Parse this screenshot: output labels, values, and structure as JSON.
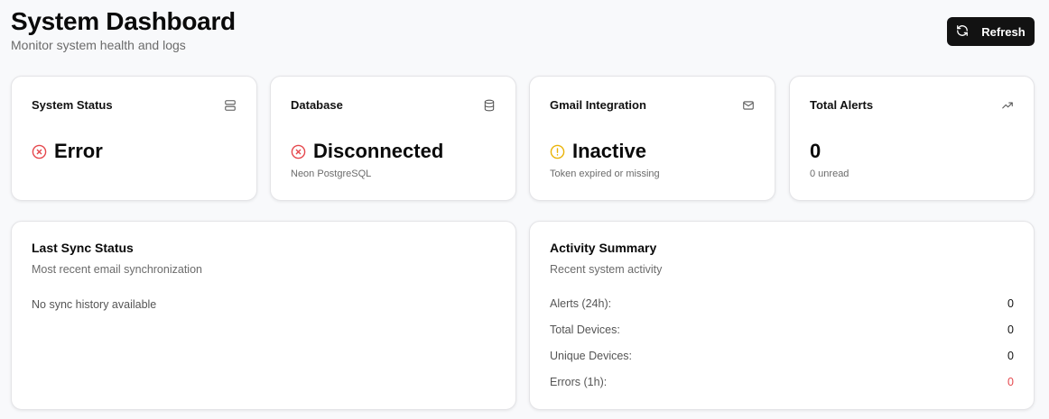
{
  "header": {
    "title": "System Dashboard",
    "subtitle": "Monitor system health and logs",
    "refresh_label": "Refresh"
  },
  "stats": [
    {
      "label": "System Status",
      "icon": "server-icon",
      "value": "Error",
      "status_icon": "x-circle-icon",
      "sub": ""
    },
    {
      "label": "Database",
      "icon": "database-icon",
      "value": "Disconnected",
      "status_icon": "x-circle-icon",
      "sub": "Neon PostgreSQL"
    },
    {
      "label": "Gmail Integration",
      "icon": "mail-icon",
      "value": "Inactive",
      "status_icon": "alert-circle-icon",
      "sub": "Token expired or missing"
    },
    {
      "label": "Total Alerts",
      "icon": "trending-up-icon",
      "value": "0",
      "sub": "0 unread"
    }
  ],
  "sync": {
    "title": "Last Sync Status",
    "description": "Most recent email synchronization",
    "empty": "No sync history available"
  },
  "activity": {
    "title": "Activity Summary",
    "description": "Recent system activity",
    "rows": [
      {
        "label": "Alerts (24h):",
        "value": "0"
      },
      {
        "label": "Total Devices:",
        "value": "0"
      },
      {
        "label": "Unique Devices:",
        "value": "0"
      },
      {
        "label": "Errors (1h):",
        "value": "0"
      }
    ]
  },
  "colors": {
    "error": "#e5484d",
    "warning": "#eab308",
    "button_bg": "#121212"
  }
}
